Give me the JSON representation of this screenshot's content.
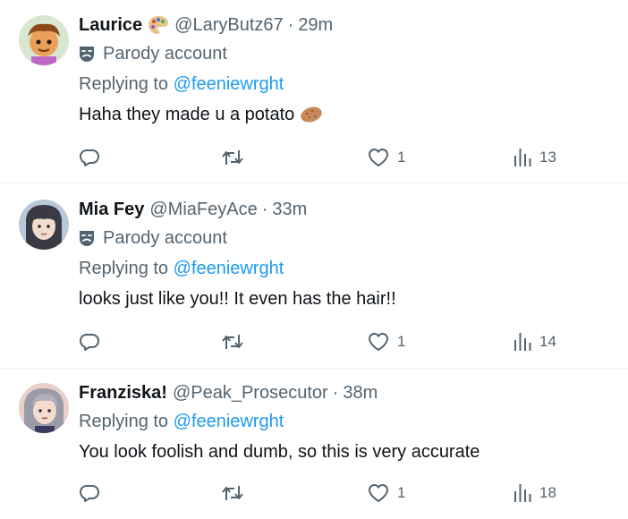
{
  "tweets": [
    {
      "name": "Laurice",
      "name_emoji": "artist-palette-emoji",
      "handle": "@LaryButz67",
      "separator": "·",
      "time": "29m",
      "parody_label": "Parody account",
      "replying_prefix": "Replying to",
      "replying_to": "@feeniewrght",
      "text": "Haha they made u a potato",
      "text_emoji": "potato-emoji",
      "replies": "",
      "retweets": "",
      "likes": "1",
      "views": "13"
    },
    {
      "name": "Mia Fey",
      "handle": "@MiaFeyAce",
      "separator": "·",
      "time": "33m",
      "parody_label": "Parody account",
      "replying_prefix": "Replying to",
      "replying_to": "@feeniewrght",
      "text": "looks just like you!! It even has the hair!!",
      "replies": "",
      "retweets": "",
      "likes": "1",
      "views": "14"
    },
    {
      "name": "Franziska!",
      "handle": "@Peak_Prosecutor",
      "separator": "·",
      "time": "38m",
      "replying_prefix": "Replying to",
      "replying_to": "@feeniewrght",
      "text": "You look foolish and dumb, so this is very accurate",
      "replies": "",
      "retweets": "",
      "likes": "1",
      "views": "18"
    }
  ],
  "colors": {
    "text_primary": "#0f1419",
    "text_secondary": "#536471",
    "link": "#1d9bf0",
    "divider": "#eff3f4"
  }
}
